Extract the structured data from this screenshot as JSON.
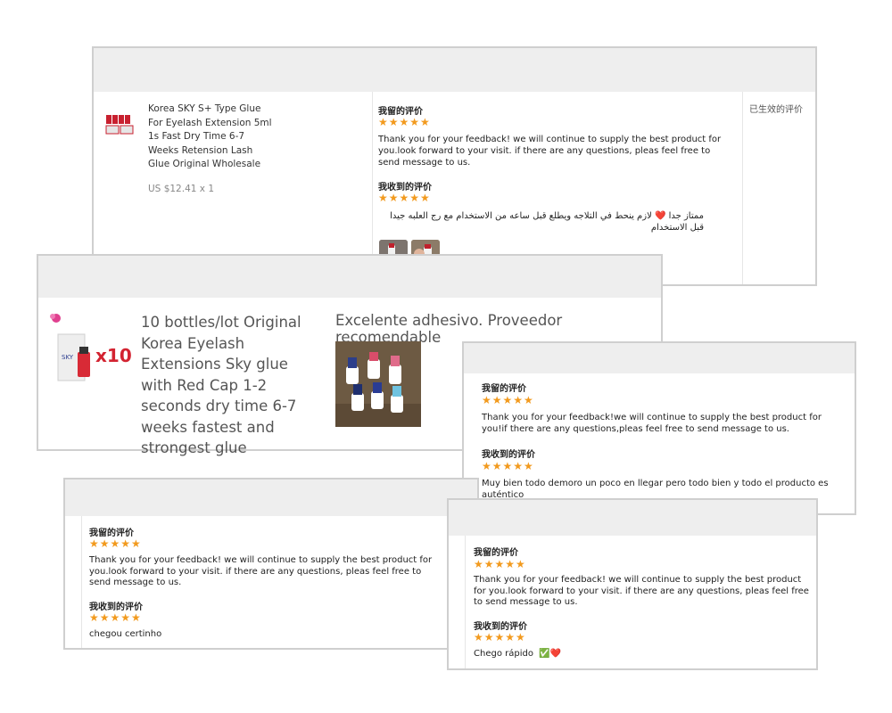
{
  "colors": {
    "star": "#f29a1e",
    "header_bg": "#eeeeee",
    "border": "#cfcfcf",
    "muted": "#888888"
  },
  "common": {
    "my_review_label": "我留的评价",
    "received_review_label": "我收到的评价",
    "stars": "★★★★★"
  },
  "card1": {
    "product_title": "Korea SKY S+ Type Glue For Eyelash Extension 5ml 1s Fast Dry Time 6-7 Weeks Retension Lash Glue Original Wholesale",
    "price": "US $12.41 x 1",
    "my_review": "Thank you for your feedback! we will continue to supply the best product for you.look forward to your visit. if there are any questions, pleas feel free to send message to us.",
    "received_review": "ممتاز جدا ❤️ لازم ينحط في التلاجه ويطلع قبل ساعه من الاستخدام مع رج العلبه جيدا قبل الاستخدام",
    "status": "已生效的评价"
  },
  "card2": {
    "product_title": "10 bottles/lot Original Korea Eyelash Extensions Sky glue with Red Cap 1-2 seconds dry time 6-7 weeks fastest and strongest glue",
    "qty_badge": "x10",
    "review": "Excelente adhesivo. Proveedor recomendable"
  },
  "card3": {
    "my_review": "Thank you for your feedback!we will continue to supply the best product for you!if there are any questions,pleas feel free to send message to us.",
    "received_review": "Muy bien todo demoro un poco en llegar pero todo bien y todo el producto es auténtico"
  },
  "card4": {
    "my_review": "Thank you for your feedback! we will continue to supply the best product for you.look forward to your visit. if there are any questions, pleas feel free to send message to us.",
    "received_review": "chegou certinho"
  },
  "card5": {
    "my_review": "Thank you for your feedback! we will continue to supply the best product for you.look forward to your visit. if there are any questions, pleas feel free to send message to us.",
    "received_review": "Chego rápido",
    "received_emojis": "✅❤️"
  }
}
